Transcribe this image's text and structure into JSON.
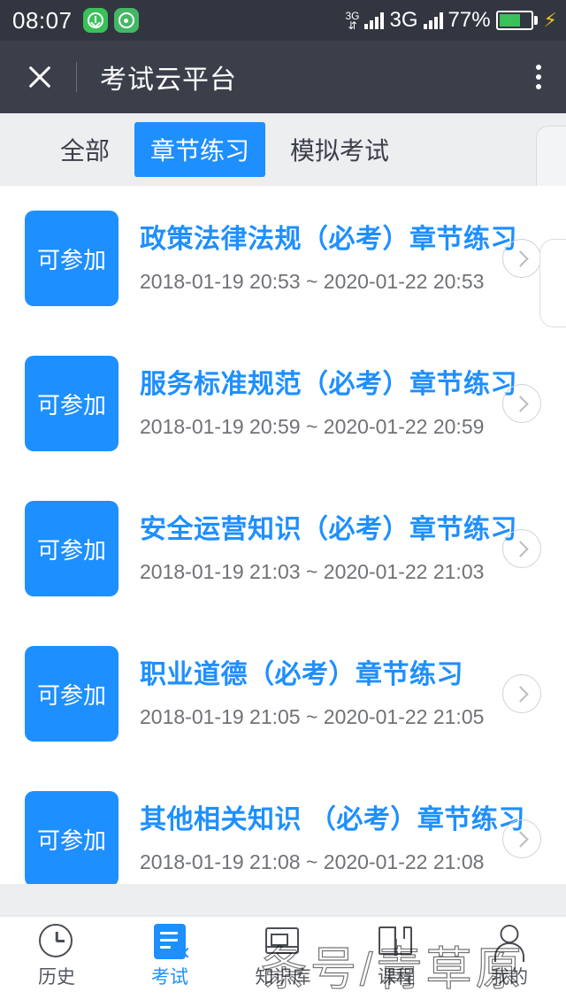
{
  "statusbar": {
    "time": "08:07",
    "icons": [
      "download-badge-icon",
      "broadcast-badge-icon"
    ],
    "network_small_label": "3G",
    "network_label": "3G",
    "battery_percent": "77%",
    "charging": "charging-bolt-icon",
    "colors": {
      "bar_bg": "#323640",
      "accent_green": "#3ac15a",
      "bolt": "#f5c518"
    }
  },
  "appbar": {
    "close_label": "close-icon",
    "title": "考试云平台",
    "menu_label": "more-options-icon",
    "bg": "#3b3f4a"
  },
  "tabs": {
    "items": [
      {
        "label": "全部",
        "active": false
      },
      {
        "label": "章节练习",
        "active": true
      },
      {
        "label": "模拟考试",
        "active": false
      }
    ],
    "active_color": "#1e8fff",
    "bar_bg": "#eceef0"
  },
  "list": {
    "badge_label": "可参加",
    "badge_color": "#1e8fff",
    "title_color": "#1e8fff",
    "items": [
      {
        "status": "可参加",
        "title": "政策法律法规（必考）章节练习",
        "date_range": "2018-01-19 20:53 ~ 2020-01-22 20:53"
      },
      {
        "status": "可参加",
        "title": "服务标准规范（必考）章节练习",
        "date_range": "2018-01-19 20:59 ~ 2020-01-22 20:59"
      },
      {
        "status": "可参加",
        "title": "安全运营知识（必考）章节练习",
        "date_range": "2018-01-19 21:03 ~ 2020-01-22 21:03"
      },
      {
        "status": "可参加",
        "title": "职业道德（必考）章节练习",
        "date_range": "2018-01-19 21:05 ~ 2020-01-22 21:05"
      },
      {
        "status": "可参加",
        "title": "其他相关知识 （必考）章节练习",
        "date_range": "2018-01-19 21:08 ~ 2020-01-22 21:08"
      }
    ]
  },
  "bottomnav": {
    "items": [
      {
        "label": "历史",
        "icon": "clock-icon",
        "active": false
      },
      {
        "label": "考试",
        "icon": "exam-document-icon",
        "active": true
      },
      {
        "label": "知识库",
        "icon": "book-icon",
        "active": false
      },
      {
        "label": "课程",
        "icon": "course-icon",
        "active": false
      },
      {
        "label": "我的",
        "icon": "person-icon",
        "active": false
      }
    ],
    "active_color": "#1e8fff"
  },
  "watermark": {
    "text": "条号/青草原"
  }
}
